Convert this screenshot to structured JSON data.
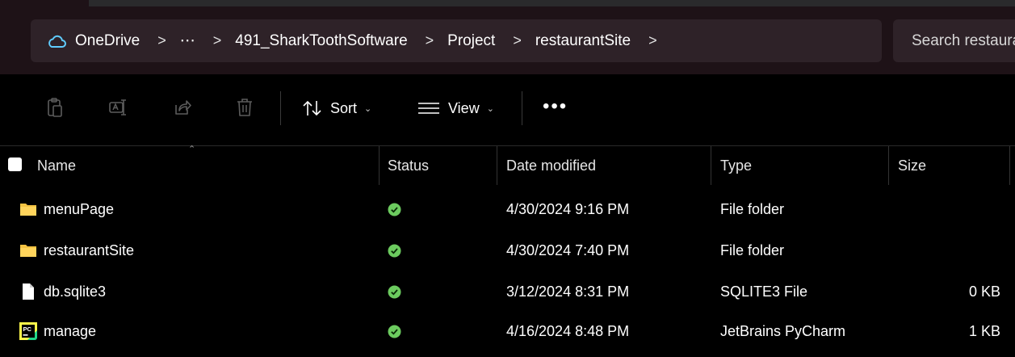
{
  "address_bar": {
    "breadcrumbs": [
      "OneDrive",
      "⋯",
      "491_SharkToothSoftware",
      "Project",
      "restaurantSite"
    ],
    "separator": ">",
    "search_placeholder": "Search restaurantSite"
  },
  "toolbar": {
    "sort_label": "Sort",
    "view_label": "View",
    "more_label": "•••"
  },
  "columns": {
    "name": "Name",
    "status": "Status",
    "date_modified": "Date modified",
    "type": "Type",
    "size": "Size"
  },
  "files": [
    {
      "name": "menuPage",
      "icon": "folder-icon",
      "status": "synced",
      "date": "4/30/2024 9:16 PM",
      "type": "File folder",
      "size": ""
    },
    {
      "name": "restaurantSite",
      "icon": "folder-icon",
      "status": "synced",
      "date": "4/30/2024 7:40 PM",
      "type": "File folder",
      "size": ""
    },
    {
      "name": "db.sqlite3",
      "icon": "document-icon",
      "status": "synced",
      "date": "3/12/2024 8:31 PM",
      "type": "SQLITE3 File",
      "size": "0 KB"
    },
    {
      "name": "manage",
      "icon": "pycharm-icon",
      "status": "synced",
      "date": "4/16/2024 8:48 PM",
      "type": "JetBrains PyCharm",
      "size": "1 KB"
    }
  ],
  "colors": {
    "folder": "#f5c342",
    "synced": "#6ccb5f",
    "accent_cloud": "#60cdff"
  }
}
